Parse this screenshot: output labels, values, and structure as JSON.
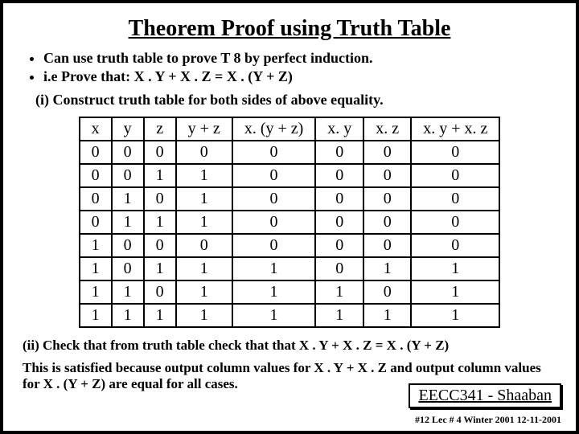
{
  "title": "Theorem Proof using Truth Table",
  "bullets": [
    "Can use truth table to prove T 8 by perfect induction.",
    "i.e    Prove that:   X . Y + X . Z = X . (Y + Z)"
  ],
  "step_i": "(i) Construct truth table for both sides of above equality.",
  "table": {
    "headers": [
      "x",
      "y",
      "z",
      "y + z",
      "x. (y + z)",
      "x. y",
      "x. z",
      "x. y +  x. z"
    ],
    "rows": [
      [
        "0",
        "0",
        "0",
        "0",
        "0",
        "0",
        "0",
        "0"
      ],
      [
        "0",
        "0",
        "1",
        "1",
        "0",
        "0",
        "0",
        "0"
      ],
      [
        "0",
        "1",
        "0",
        "1",
        "0",
        "0",
        "0",
        "0"
      ],
      [
        "0",
        "1",
        "1",
        "1",
        "0",
        "0",
        "0",
        "0"
      ],
      [
        "1",
        "0",
        "0",
        "0",
        "0",
        "0",
        "0",
        "0"
      ],
      [
        "1",
        "0",
        "1",
        "1",
        "1",
        "0",
        "1",
        "1"
      ],
      [
        "1",
        "1",
        "0",
        "1",
        "1",
        "1",
        "0",
        "1"
      ],
      [
        "1",
        "1",
        "1",
        "1",
        "1",
        "1",
        "1",
        "1"
      ]
    ]
  },
  "step_ii": "(ii) Check that   from truth table check that that  X . Y + X . Z  =  X . (Y + Z)",
  "conclusion": "This is satisfied because output column  values for  X . Y + X . Z  and output column values for  X . (Y + Z)   are equal for all cases.",
  "footer_course": "EECC341 - Shaaban",
  "footer_meta": "#12  Lec # 4   Winter 2001  12-11-2001"
}
